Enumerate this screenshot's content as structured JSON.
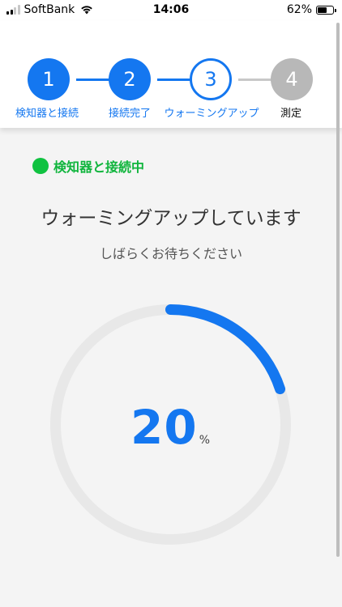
{
  "status_bar": {
    "carrier": "SoftBank",
    "time": "14:06",
    "battery": "62%",
    "battery_level": 0.62
  },
  "stepper": {
    "steps": [
      {
        "number": "1",
        "label": "検知器と接続",
        "state": "done"
      },
      {
        "number": "2",
        "label": "接続完了",
        "state": "done"
      },
      {
        "number": "3",
        "label": "ウォーミングアップ",
        "state": "current"
      },
      {
        "number": "4",
        "label": "測定",
        "state": "pending"
      }
    ]
  },
  "connection": {
    "status_text": "検知器と接続中",
    "color": "#10c241"
  },
  "main": {
    "title": "ウォーミングアップしています",
    "subtitle": "しばらくお待ちください"
  },
  "progress": {
    "value": "20",
    "unit": "%",
    "fraction": 0.2,
    "accent_color": "#1477f0",
    "track_color": "#e8e8e8"
  }
}
